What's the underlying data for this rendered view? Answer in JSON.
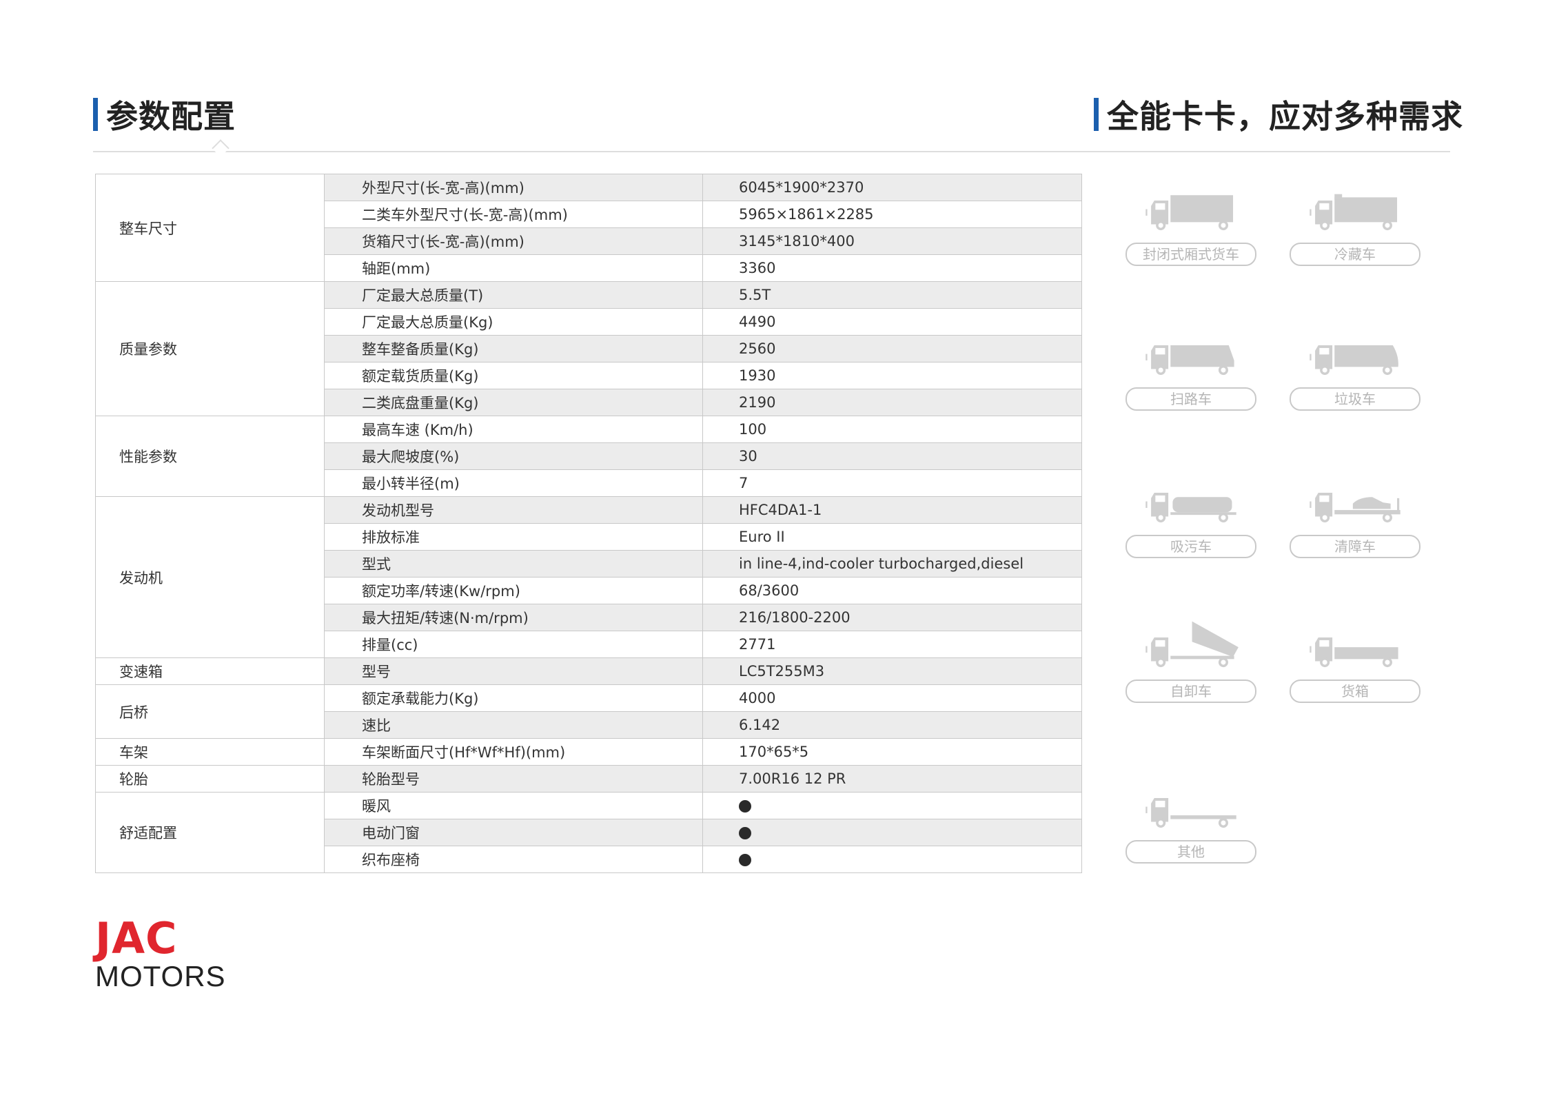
{
  "header": {
    "left_title": "参数配置",
    "right_title": "全能卡卡，应对多种需求"
  },
  "spec_table": {
    "rows": [
      {
        "category": "整车尺寸",
        "param": "外型尺寸(长-宽-高)(mm)",
        "value": "6045*1900*2370"
      },
      {
        "category": "",
        "param": "二类车外型尺寸(长-宽-高)(mm)",
        "value": "5965×1861×2285"
      },
      {
        "category": "",
        "param": "货箱尺寸(长-宽-高)(mm)",
        "value": "3145*1810*400"
      },
      {
        "category": "",
        "param": "轴距(mm)",
        "value": "3360"
      },
      {
        "category": "质量参数",
        "param": "厂定最大总质量(T)",
        "value": "5.5T"
      },
      {
        "category": "",
        "param": "厂定最大总质量(Kg)",
        "value": "4490"
      },
      {
        "category": "",
        "param": "整车整备质量(Kg)",
        "value": "2560"
      },
      {
        "category": "",
        "param": "额定载货质量(Kg)",
        "value": "1930"
      },
      {
        "category": "",
        "param": "二类底盘重量(Kg)",
        "value": "2190"
      },
      {
        "category": "性能参数",
        "param": "最高车速 (Km/h)",
        "value": "100"
      },
      {
        "category": "",
        "param": "最大爬坡度(%)",
        "value": "30"
      },
      {
        "category": "",
        "param": "最小转半径(m)",
        "value": "7"
      },
      {
        "category": "发动机",
        "param": "发动机型号",
        "value": "HFC4DA1-1"
      },
      {
        "category": "",
        "param": "排放标准",
        "value": "Euro II"
      },
      {
        "category": "",
        "param": "型式",
        "value": "in line-4,ind-cooler turbocharged,diesel"
      },
      {
        "category": "",
        "param": "额定功率/转速(Kw/rpm)",
        "value": "68/3600"
      },
      {
        "category": "",
        "param": "最大扭矩/转速(N·m/rpm)",
        "value": "216/1800-2200"
      },
      {
        "category": "",
        "param": "排量(cc)",
        "value": "2771"
      },
      {
        "category": "变速箱",
        "param": "型号",
        "value": "LC5T255M3"
      },
      {
        "category": "后桥",
        "param": "额定承载能力(Kg)",
        "value": "4000"
      },
      {
        "category": "",
        "param": "速比",
        "value": "6.142"
      },
      {
        "category": "车架",
        "param": "车架断面尺寸(Hf*Wf*Hf)(mm)",
        "value": "170*65*5"
      },
      {
        "category": "轮胎",
        "param": "轮胎型号",
        "value": "7.00R16 12 PR"
      },
      {
        "category": "舒适配置",
        "param": "暖风",
        "value": "●"
      },
      {
        "category": "",
        "param": "电动门窗",
        "value": "●"
      },
      {
        "category": "",
        "param": "织布座椅",
        "value": "●"
      }
    ]
  },
  "vehicles": [
    {
      "label": "封闭式厢式货车",
      "icon": "box-truck-icon"
    },
    {
      "label": "冷藏车",
      "icon": "refrigerated-truck-icon"
    },
    {
      "label": "扫路车",
      "icon": "street-sweeper-icon"
    },
    {
      "label": "垃圾车",
      "icon": "garbage-truck-icon"
    },
    {
      "label": "吸污车",
      "icon": "tanker-truck-icon"
    },
    {
      "label": "清障车",
      "icon": "tow-truck-icon"
    },
    {
      "label": "自卸车",
      "icon": "dump-truck-icon"
    },
    {
      "label": "货箱",
      "icon": "cargo-truck-icon"
    },
    {
      "label": "其他",
      "icon": "chassis-truck-icon"
    }
  ],
  "brand": {
    "logo_top": "JAC",
    "logo_bottom": "MOTORS",
    "color": "#e0262e"
  }
}
